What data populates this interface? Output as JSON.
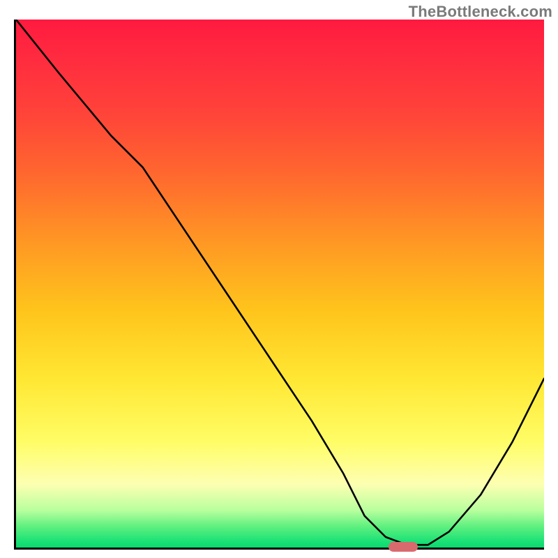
{
  "watermark": "TheBottleneck.com",
  "chart_data": {
    "type": "line",
    "title": "",
    "xlabel": "",
    "ylabel": "",
    "xlim": [
      0,
      100
    ],
    "ylim": [
      0,
      100
    ],
    "grid": false,
    "series": [
      {
        "name": "bottleneck-curve",
        "x": [
          0,
          8,
          18,
          24,
          32,
          40,
          48,
          56,
          62,
          66,
          70,
          74,
          78,
          82,
          88,
          94,
          100
        ],
        "y": [
          100,
          90,
          78,
          72,
          60,
          48,
          36,
          24,
          14,
          6,
          2,
          0.5,
          0.5,
          3,
          10,
          20,
          32
        ]
      }
    ],
    "marker": {
      "x": 73,
      "y": 0.5,
      "color": "#d86a6e"
    },
    "gradient_stops": [
      {
        "pct": 0,
        "color": "#ff1a3f"
      },
      {
        "pct": 30,
        "color": "#ff6a2e"
      },
      {
        "pct": 55,
        "color": "#ffc41c"
      },
      {
        "pct": 80,
        "color": "#fffd66"
      },
      {
        "pct": 96,
        "color": "#5ff07f"
      },
      {
        "pct": 100,
        "color": "#0cd86e"
      }
    ]
  }
}
